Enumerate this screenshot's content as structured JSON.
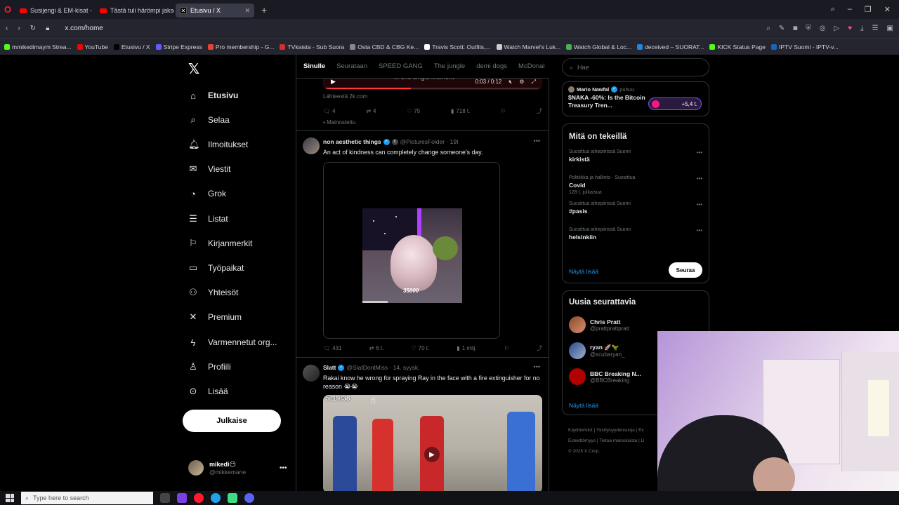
{
  "browser": {
    "tabs": [
      {
        "label": "Susijengi & EM-kisat - You",
        "icon": "youtube-icon"
      },
      {
        "label": "Tästä tuli härömpi jakso! I",
        "icon": "youtube-icon"
      },
      {
        "label": "Etusivu / X",
        "icon": "x-icon",
        "active": true
      }
    ],
    "url": "x.com/home",
    "bookmarks": [
      {
        "label": "mmikedimaym Strea...",
        "color": "#53fc18"
      },
      {
        "label": "YouTube",
        "color": "#ff0000"
      },
      {
        "label": "Etusivu / X",
        "color": "#000000"
      },
      {
        "label": "Stripe Express",
        "color": "#635bff"
      },
      {
        "label": "Pro membership - G...",
        "color": "#ea4335"
      },
      {
        "label": "TVkaista - Sub Suora",
        "color": "#d32f2f"
      },
      {
        "label": "Osta CBD & CBG Ke...",
        "color": "#888888"
      },
      {
        "label": "Travis Scott: Outfits,...",
        "color": "#ffffff"
      },
      {
        "label": "Watch Marvel's Luk...",
        "color": "#cccccc"
      },
      {
        "label": "Watch Global & Loc...",
        "color": "#4caf50"
      },
      {
        "label": "deceived – SUORAT...",
        "color": "#1e88e5"
      },
      {
        "label": "KICK Status Page",
        "color": "#53fc18"
      },
      {
        "label": "IPTV Suomi - IPTV-v...",
        "color": "#1565c0"
      }
    ]
  },
  "nav": {
    "items": [
      {
        "label": "Etusivu",
        "icon": "home-icon",
        "glyph": "⌂"
      },
      {
        "label": "Selaa",
        "icon": "search-icon",
        "glyph": "⌕"
      },
      {
        "label": "Ilmoitukset",
        "icon": "bell-icon",
        "glyph": "🔔︎"
      },
      {
        "label": "Viestit",
        "icon": "mail-icon",
        "glyph": "✉"
      },
      {
        "label": "Grok",
        "icon": "grok-icon",
        "glyph": "◔"
      },
      {
        "label": "Listat",
        "icon": "list-icon",
        "glyph": "☰"
      },
      {
        "label": "Kirjanmerkit",
        "icon": "bookmark-icon",
        "glyph": "⚐"
      },
      {
        "label": "Työpaikat",
        "icon": "briefcase-icon",
        "glyph": "▭"
      },
      {
        "label": "Yhteisöt",
        "icon": "people-icon",
        "glyph": "⚇"
      },
      {
        "label": "Premium",
        "icon": "x-icon",
        "glyph": "✕"
      },
      {
        "label": "Varmennetut org...",
        "icon": "lightning-icon",
        "glyph": "ϟ"
      },
      {
        "label": "Profiili",
        "icon": "person-icon",
        "glyph": "♙"
      },
      {
        "label": "Lisää",
        "icon": "more-circle-icon",
        "glyph": "⊙"
      }
    ],
    "post_label": "Julkaise",
    "profile": {
      "name": "mikedi😶",
      "handle": "@mikkemane"
    }
  },
  "feed": {
    "tabs": [
      "Sinulle",
      "Seurataan",
      "SPEED GANG",
      "The jungle",
      "demi dogs",
      "McDonal"
    ],
    "ad": {
      "caption": "in one single moment",
      "time": "0:03 / 0:12",
      "source": "Lähteestä 2k.com",
      "replies": "4",
      "reposts": "4",
      "likes": "75",
      "views": "718 t.",
      "label": "Mainostettu"
    },
    "tweet1": {
      "name": "non aesthetic things",
      "handle": "@PicturesFolder · 19t",
      "text": "An act of kindness can completely change someone's day.",
      "counter": "35000",
      "replies": "431",
      "reposts": "6 t.",
      "likes": "70 t.",
      "views": "1 milj."
    },
    "tweet2": {
      "name": "Slatt",
      "handle": "@SlatDontMiss · 14. syysk.",
      "text": "Rakai know he wrong for spraying Ray in the face with a fire extinguisher for no reason 😭😭",
      "timer": "5:19:38"
    }
  },
  "right": {
    "search_placeholder": "Hae",
    "live": {
      "user": "Mario Nawfal",
      "status": "puhuu",
      "title": "$NAKA -60%: Is the Bitcoin Treasury Tren...",
      "count": "+5,4 t."
    },
    "trends_title": "Mitä on tekeillä",
    "trends": [
      {
        "meta": "Suosittua aihepiirissä Suomi",
        "name": "kirkistä",
        "count": ""
      },
      {
        "meta": "Politiikka ja hallinto · Suosittua",
        "name": "Covid",
        "count": "128 t. julkaisua"
      },
      {
        "meta": "Suosittua aihepiirissä Suomi",
        "name": "#pasis",
        "count": ""
      },
      {
        "meta": "Suosittua aihepiirissä Suomi",
        "name": "helsinkiin",
        "count": ""
      }
    ],
    "show_more": "Näytä lisää",
    "follow_title": "Uusia seurattavia",
    "follow": [
      {
        "name": "Chris Pratt",
        "handle": "@prattprattpratt"
      },
      {
        "name": "ryan 🚀🦖",
        "handle": "@scubaryan_"
      },
      {
        "name": "BBC Breaking N...",
        "handle": "@BBCBreaking"
      }
    ],
    "follow_btn": "Seuraa",
    "footer": [
      "Käyttöehdot | Yksityisyydensuoja | Ev",
      "Esteettömyys | Tietoa mainoksista | Li",
      "© 2025 X Corp."
    ]
  },
  "taskbar": {
    "search": "Type here to search"
  }
}
